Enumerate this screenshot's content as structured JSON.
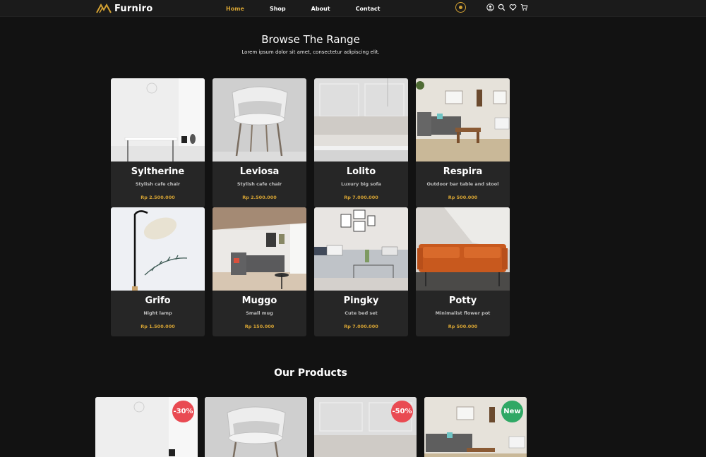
{
  "header": {
    "brand": "Furniro",
    "nav": [
      {
        "label": "Home",
        "active": true
      },
      {
        "label": "Shop",
        "active": false
      },
      {
        "label": "About",
        "active": false
      },
      {
        "label": "Contact",
        "active": false
      }
    ],
    "icons": [
      "user-icon",
      "search-icon",
      "heart-icon",
      "cart-icon"
    ]
  },
  "browse": {
    "title": "Browse The Range",
    "subtitle": "Lorem ipsum dolor sit amet, consectetur adipiscing elit.",
    "items": [
      {
        "name": "Syltherine",
        "desc": "Stylish cafe chair",
        "price": "Rp 2.500.000"
      },
      {
        "name": "Leviosa",
        "desc": "Stylish cafe chair",
        "price": "Rp 2.500.000"
      },
      {
        "name": "Lolito",
        "desc": "Luxury big sofa",
        "price": "Rp 7.000.000"
      },
      {
        "name": "Respira",
        "desc": "Outdoor bar table and stool",
        "price": "Rp 500.000"
      },
      {
        "name": "Grifo",
        "desc": "Night lamp",
        "price": "Rp 1.500.000"
      },
      {
        "name": "Muggo",
        "desc": "Small mug",
        "price": "Rp 150.000"
      },
      {
        "name": "Pingky",
        "desc": "Cute bed set",
        "price": "Rp 7.000.000"
      },
      {
        "name": "Potty",
        "desc": "Minimalist flower pot",
        "price": "Rp 500.000"
      }
    ]
  },
  "products": {
    "title": "Our Products",
    "badges": [
      "-30%",
      "",
      "-50%",
      "New"
    ]
  },
  "colors": {
    "accent": "#d4a233",
    "sale": "#e94a52",
    "new": "#2fa865",
    "background": "#121212",
    "card": "#262626"
  }
}
